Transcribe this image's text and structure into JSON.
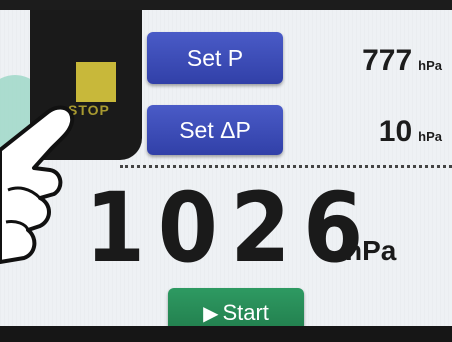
{
  "stop": {
    "label": "STOP"
  },
  "controls": {
    "set_p": {
      "label": "Set P",
      "value": "777",
      "unit": "hPa"
    },
    "set_dp": {
      "label": "Set ΔP",
      "value": "10",
      "unit": "hPa"
    }
  },
  "reading": {
    "value": "1026",
    "unit": "hPa"
  },
  "start": {
    "label": "Start",
    "icon": "play-icon"
  },
  "colors": {
    "blue_button": "#3a4bb8",
    "green_button": "#28895a",
    "stop_square": "#c8b83a",
    "screen": "#eef1f4"
  }
}
